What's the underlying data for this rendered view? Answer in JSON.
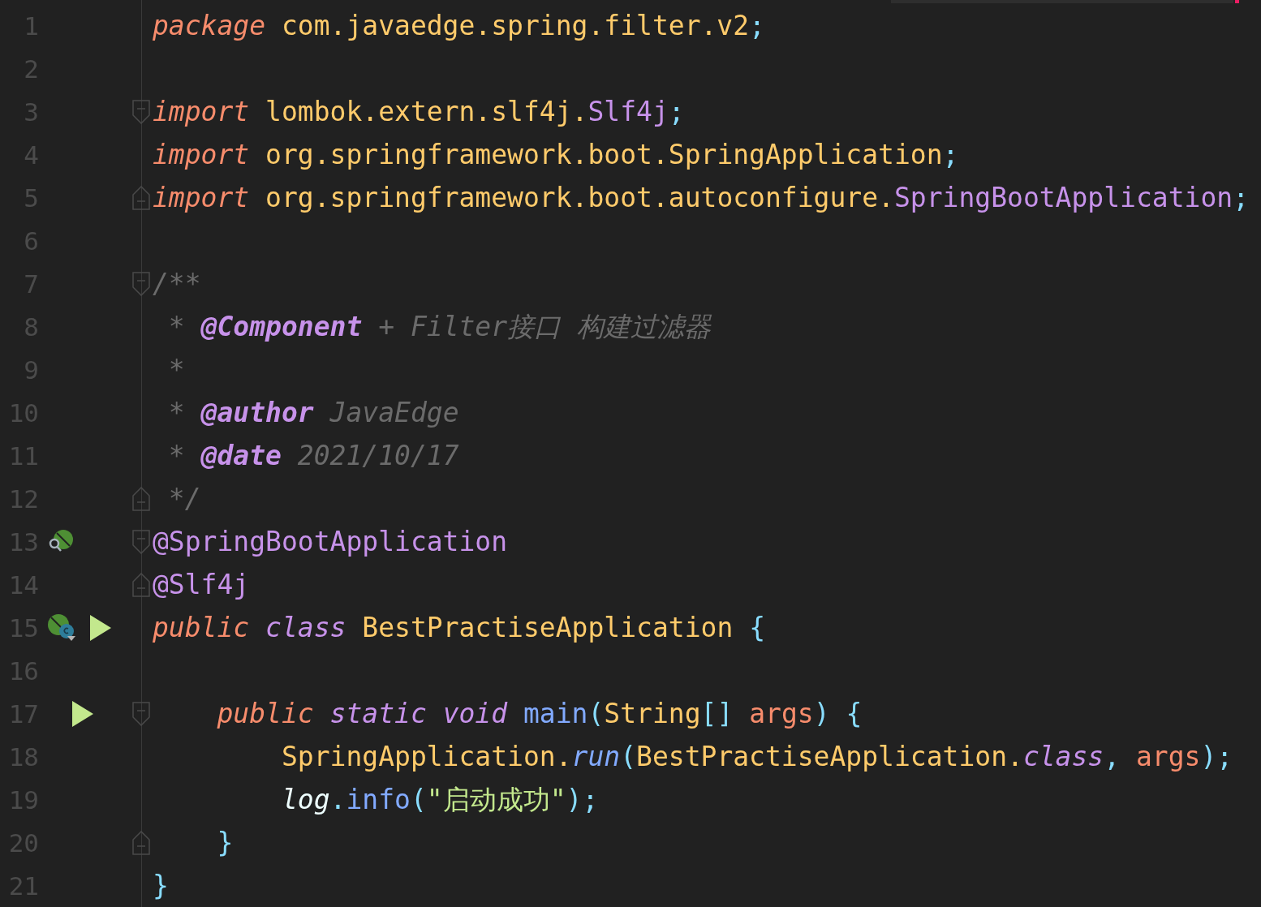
{
  "lines": [
    {
      "number": "1",
      "tokens": [
        {
          "kind": "keyword",
          "text": "package"
        },
        {
          "kind": "plain",
          "text": " com.javaedge.spring.filter.v2"
        },
        {
          "kind": "punct",
          "text": ";"
        }
      ]
    },
    {
      "number": "2"
    },
    {
      "number": "3",
      "fold": {
        "kind": "start"
      },
      "tokens": [
        {
          "kind": "keyword",
          "text": "import"
        },
        {
          "kind": "plain",
          "text": " lombok.extern.slf4j."
        },
        {
          "kind": "type",
          "text": "Slf4j"
        },
        {
          "kind": "punct",
          "text": ";"
        }
      ]
    },
    {
      "number": "4",
      "tokens": [
        {
          "kind": "keyword",
          "text": "import"
        },
        {
          "kind": "plain",
          "text": " org.springframework.boot.SpringApplication"
        },
        {
          "kind": "punct",
          "text": ";"
        }
      ]
    },
    {
      "number": "5",
      "fold": {
        "kind": "end"
      },
      "tokens": [
        {
          "kind": "keyword",
          "text": "import"
        },
        {
          "kind": "plain",
          "text": " org.springframework.boot.autoconfigure."
        },
        {
          "kind": "type",
          "text": "SpringBootApplication"
        },
        {
          "kind": "punct",
          "text": ";"
        }
      ]
    },
    {
      "number": "6"
    },
    {
      "number": "7",
      "fold": {
        "kind": "start"
      },
      "tokens": [
        {
          "kind": "comment",
          "text": "/**"
        }
      ]
    },
    {
      "number": "8",
      "tokens": [
        {
          "kind": "comment",
          "text": " * "
        },
        {
          "kind": "doctag",
          "text": "@Component"
        },
        {
          "kind": "comment",
          "text": " + Filter接口 构建过滤器"
        }
      ]
    },
    {
      "number": "9",
      "tokens": [
        {
          "kind": "comment",
          "text": " *"
        }
      ]
    },
    {
      "number": "10",
      "tokens": [
        {
          "kind": "comment",
          "text": " * "
        },
        {
          "kind": "doctag",
          "text": "@author"
        },
        {
          "kind": "comment",
          "text": " JavaEdge"
        }
      ]
    },
    {
      "number": "11",
      "tokens": [
        {
          "kind": "comment",
          "text": " * "
        },
        {
          "kind": "doctag",
          "text": "@date"
        },
        {
          "kind": "comment",
          "text": " 2021/10/17"
        }
      ]
    },
    {
      "number": "12",
      "fold": {
        "kind": "end"
      },
      "tokens": [
        {
          "kind": "comment",
          "text": " */"
        }
      ]
    },
    {
      "number": "13",
      "fold": {
        "kind": "start"
      },
      "gutter": [
        {
          "kind": "bean-search"
        }
      ],
      "tokens": [
        {
          "kind": "annotation",
          "text": "@SpringBootApplication"
        }
      ]
    },
    {
      "number": "14",
      "fold": {
        "kind": "end"
      },
      "tokens": [
        {
          "kind": "annotation",
          "text": "@Slf4j"
        }
      ]
    },
    {
      "number": "15",
      "gutter": [
        {
          "kind": "bean-class"
        },
        {
          "kind": "run"
        }
      ],
      "tokens": [
        {
          "kind": "keyword",
          "text": "public"
        },
        {
          "kind": "modifier",
          "text": " class"
        },
        {
          "kind": "plain",
          "text": " BestPractiseApplication "
        },
        {
          "kind": "punct",
          "text": "{"
        }
      ]
    },
    {
      "number": "16"
    },
    {
      "number": "17",
      "fold": {
        "kind": "start"
      },
      "gutter": [
        {
          "kind": "run"
        }
      ],
      "tokens": [
        {
          "kind": "keyword",
          "text": "    public"
        },
        {
          "kind": "modifier",
          "text": " static void"
        },
        {
          "kind": "method",
          "text": " main"
        },
        {
          "kind": "punct",
          "text": "("
        },
        {
          "kind": "plain",
          "text": "String"
        },
        {
          "kind": "punct",
          "text": "[]"
        },
        {
          "kind": "param",
          "text": " args"
        },
        {
          "kind": "punct",
          "text": ") {"
        }
      ]
    },
    {
      "number": "18",
      "tokens": [
        {
          "kind": "plain",
          "text": "        SpringApplication."
        },
        {
          "kind": "call",
          "text": "run"
        },
        {
          "kind": "punct",
          "text": "("
        },
        {
          "kind": "plain",
          "text": "BestPractiseApplication."
        },
        {
          "kind": "modifier",
          "text": "class"
        },
        {
          "kind": "punct",
          "text": ", "
        },
        {
          "kind": "param",
          "text": "args"
        },
        {
          "kind": "punct",
          "text": ");"
        }
      ]
    },
    {
      "number": "19",
      "tokens": [
        {
          "kind": "field",
          "text": "        log"
        },
        {
          "kind": "punct",
          "text": "."
        },
        {
          "kind": "method",
          "text": "info"
        },
        {
          "kind": "punct",
          "text": "("
        },
        {
          "kind": "string",
          "text": "\"启动成功\""
        },
        {
          "kind": "punct",
          "text": ");"
        }
      ]
    },
    {
      "number": "20",
      "fold": {
        "kind": "end"
      },
      "tokens": [
        {
          "kind": "punct",
          "text": "    }"
        }
      ]
    },
    {
      "number": "21",
      "tokens": [
        {
          "kind": "punct",
          "text": "}"
        }
      ]
    }
  ]
}
